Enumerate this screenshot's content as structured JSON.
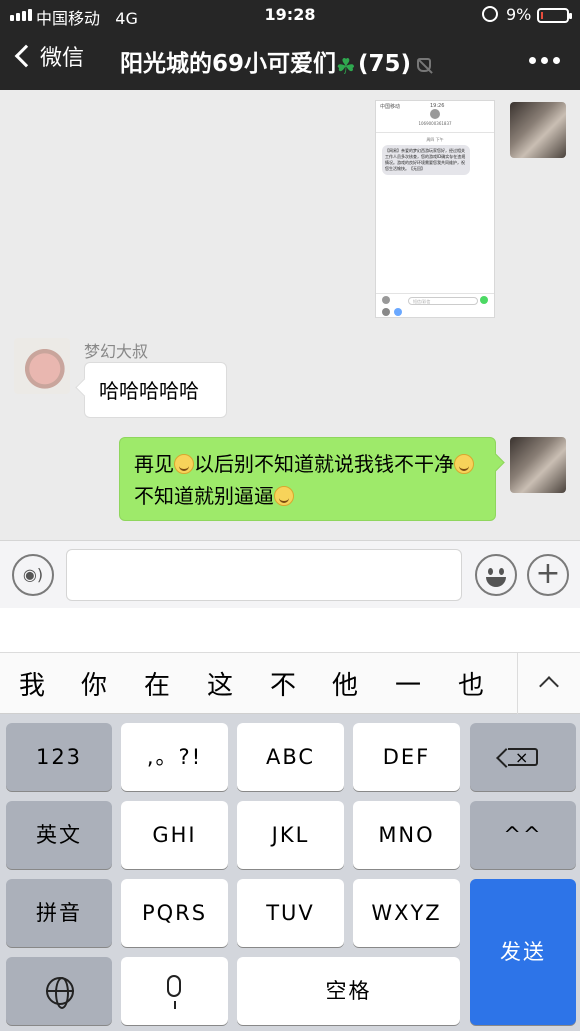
{
  "status_bar": {
    "carrier": "中国移动",
    "network": "4G",
    "time": "19:28",
    "battery": "9%",
    "battery_level": 0.09
  },
  "nav": {
    "back_label": "微信",
    "chat_title": "阳光城的69小可爱们",
    "title_emoji_icon": "shamrock-icon",
    "member_count": "(75)",
    "more_icon": "more-dots-icon"
  },
  "messages": [
    {
      "from": "self",
      "type": "image",
      "image": {
        "status_carrier": "中国移动",
        "status_time": "19:26",
        "number": "1069000361837",
        "timestamp": "周四 下午",
        "sms_text": "【网易】亲爱的梦幻西游玩家您好，经过相关工作人员多次核查，您的游戏ID确实存在违规情况。游戏的良好环境需要您我共同维护，祝您生活愉快。【无回】",
        "input_placeholder": "短信/彩信"
      }
    },
    {
      "from": "other",
      "sender_name": "梦幻大叔",
      "text": "哈哈哈哈哈"
    },
    {
      "from": "self",
      "type": "text",
      "parts": [
        "再见",
        "以后别不知道就说我钱不干净",
        "不知道就别逼逼"
      ],
      "emoji": "smile-emoji"
    }
  ],
  "input_bar": {
    "voice_icon": "voice-icon",
    "emoji_icon": "emoji-icon",
    "plus_icon": "plus-icon",
    "text_value": ""
  },
  "candidates": [
    "我",
    "你",
    "在",
    "这",
    "不",
    "他",
    "一",
    "也"
  ],
  "keyboard": {
    "row1": [
      "123",
      ",。?!",
      "ABC",
      "DEF"
    ],
    "row2": [
      "英文",
      "GHI",
      "JKL",
      "MNO",
      "^^"
    ],
    "row3": [
      "拼音",
      "PQRS",
      "TUV",
      "WXYZ"
    ],
    "space": "空格",
    "send": "发送"
  },
  "colors": {
    "nav_bg": "#262626",
    "self_bubble": "#9eea6a",
    "send_key": "#2d74e8"
  }
}
